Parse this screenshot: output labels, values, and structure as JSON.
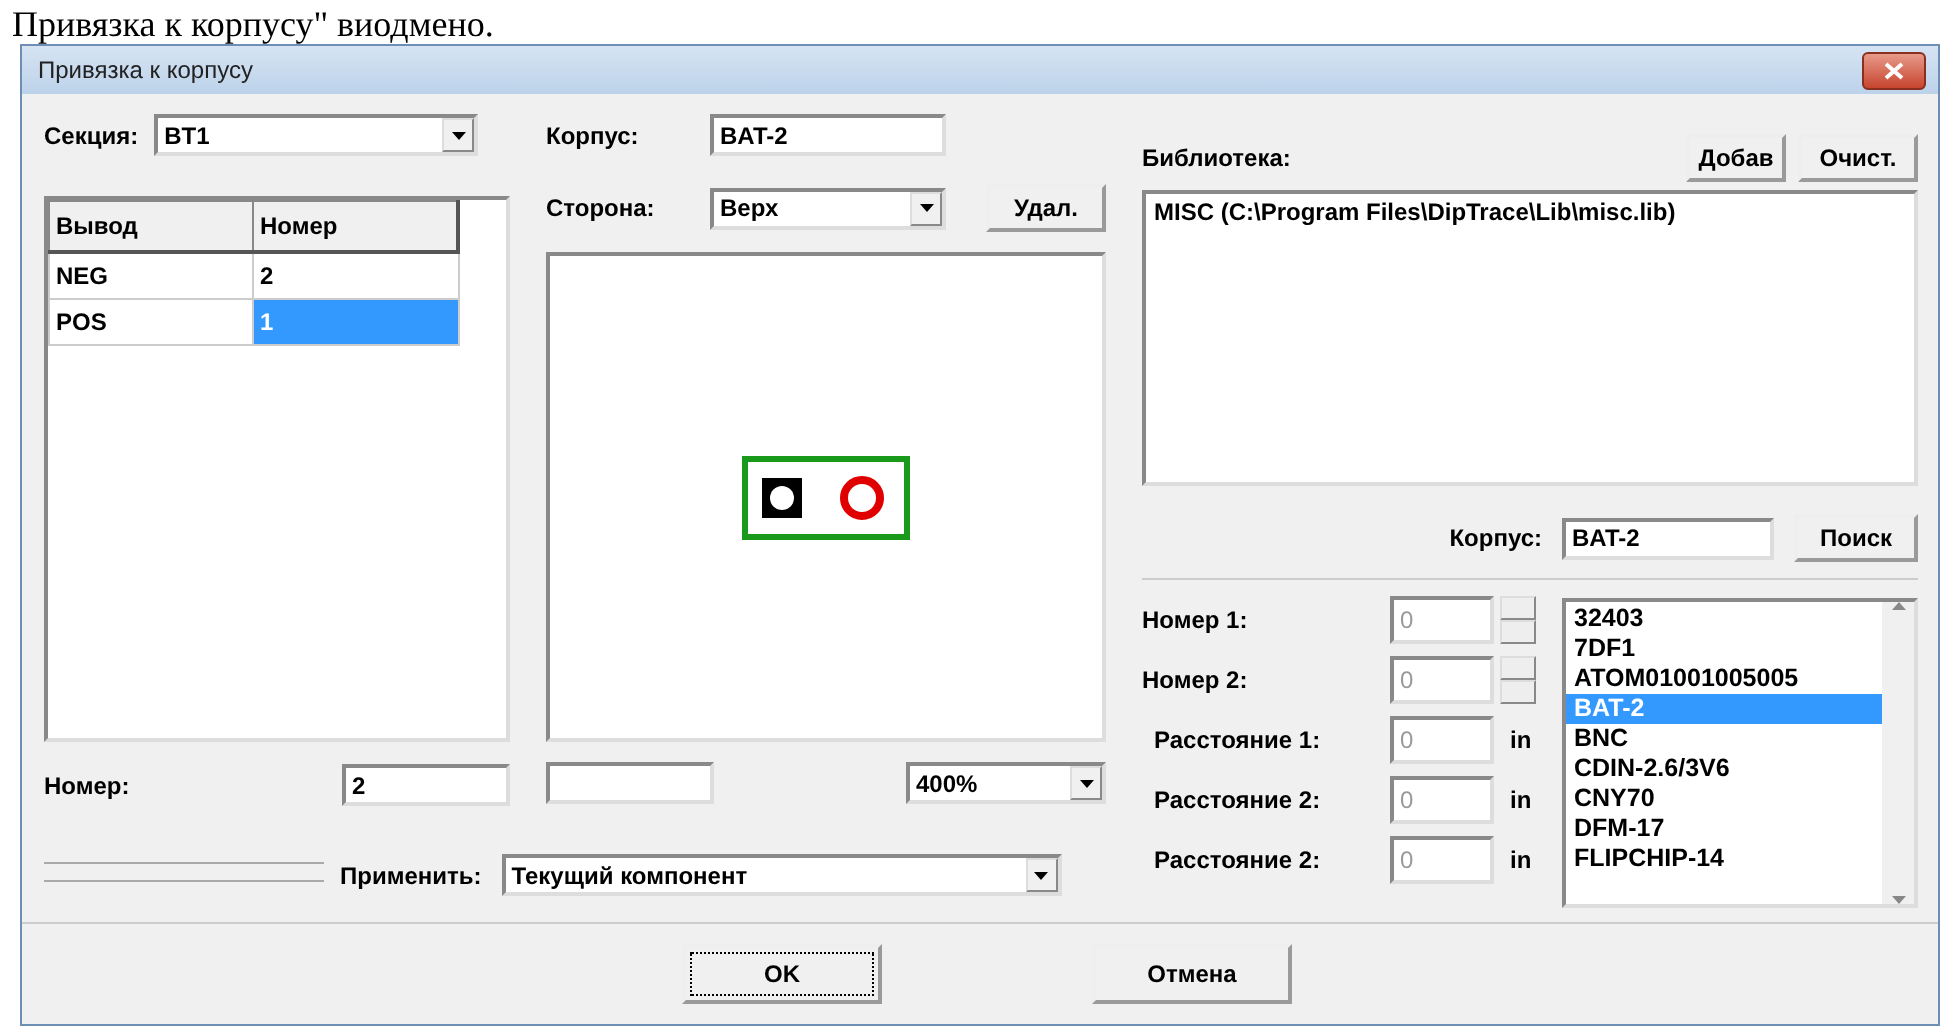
{
  "caption": "Привязка к корпусу\" виодмено.",
  "window": {
    "title": "Привязка к корпусу"
  },
  "section": {
    "label": "Секция:",
    "value": "BT1"
  },
  "pins": {
    "columns": [
      "Вывод",
      "Номер"
    ],
    "rows": [
      {
        "cells": [
          "NEG",
          "2"
        ],
        "selected": false
      },
      {
        "cells": [
          "POS",
          "1"
        ],
        "selected": true
      }
    ]
  },
  "number": {
    "label": "Номер:",
    "value": "2"
  },
  "package": {
    "label": "Корпус:",
    "value": "BAT-2"
  },
  "side": {
    "label": "Сторона:",
    "value": "Верх"
  },
  "delete_button": "Удал.",
  "zoom": {
    "value": "400%"
  },
  "apply": {
    "label": "Применить:",
    "value": "Текущий компонент"
  },
  "library": {
    "label": "Библиотека:",
    "add_button": "Добав",
    "clear_button": "Очист.",
    "items": [
      "MISC (C:\\Program Files\\DipTrace\\Lib\\misc.lib)"
    ]
  },
  "search": {
    "label": "Корпус:",
    "value": "BAT-2",
    "button": "Поиск"
  },
  "params": [
    {
      "kind": "spin",
      "label": "Номер 1:",
      "value": "0",
      "disabled": true
    },
    {
      "kind": "spin",
      "label": "Номер 2:",
      "value": "0",
      "disabled": true
    },
    {
      "kind": "unit",
      "label": "Расстояние 1:",
      "value": "0",
      "unit": "in",
      "disabled": true
    },
    {
      "kind": "unit",
      "label": "Расстояние 2:",
      "value": "0",
      "unit": "in",
      "disabled": true
    },
    {
      "kind": "unit",
      "label": "Расстояние 2:",
      "value": "0",
      "unit": "in",
      "disabled": true
    }
  ],
  "package_list": [
    {
      "label": "32403",
      "selected": false
    },
    {
      "label": "7DF1",
      "selected": false
    },
    {
      "label": "ATOM01001005005",
      "selected": false
    },
    {
      "label": "BAT-2",
      "selected": true
    },
    {
      "label": "BNC",
      "selected": false
    },
    {
      "label": "CDIN-2.6/3V6",
      "selected": false
    },
    {
      "label": "CNY70",
      "selected": false
    },
    {
      "label": "DFM-17",
      "selected": false
    },
    {
      "label": "FLIPCHIP-14",
      "selected": false
    }
  ],
  "buttons": [
    {
      "label": "OK",
      "focused": true
    },
    {
      "label": "Отмена",
      "focused": false
    }
  ]
}
